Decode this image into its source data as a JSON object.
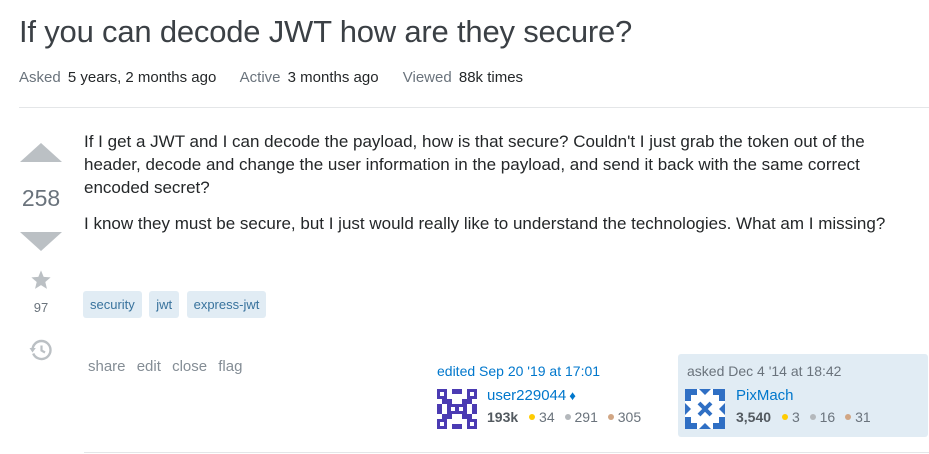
{
  "question": {
    "title": "If you can decode JWT how are they secure?",
    "meta": {
      "asked_label": "Asked",
      "asked_value": "5 years, 2 months ago",
      "active_label": "Active",
      "active_value": "3 months ago",
      "viewed_label": "Viewed",
      "viewed_value": "88k times"
    },
    "votes": {
      "score": "258",
      "favorites": "97"
    },
    "body": {
      "p1": "If I get a JWT and I can decode the payload, how is that secure? Couldn't I just grab the token out of the header, decode and change the user information in the payload, and send it back with the same correct encoded secret?",
      "p2": "I know they must be secure, but I just would really like to understand the technologies. What am I missing?"
    },
    "tags": [
      "security",
      "jwt",
      "express-jwt"
    ],
    "actions": [
      "share",
      "edit",
      "close",
      "flag"
    ],
    "editor": {
      "action": "edited Sep 20 '19 at 17:01",
      "name": "user229044",
      "moderator_glyph": "♦",
      "reputation": "193k",
      "gold": "34",
      "silver": "291",
      "bronze": "305"
    },
    "asker": {
      "action": "asked Dec 4 '14 at 18:42",
      "name": "PixMach",
      "reputation": "3,540",
      "gold": "3",
      "silver": "16",
      "bronze": "31"
    }
  },
  "icons": {
    "upvote": "arrow-up-icon",
    "downvote": "arrow-down-icon",
    "favorite": "star-icon",
    "history": "history-icon"
  },
  "colors": {
    "link": "#0077cc",
    "tag_bg": "#e1ecf4",
    "tag_text": "#39739d",
    "gold": "#ffcc01",
    "silver": "#b4b8bc",
    "bronze": "#d1a684",
    "muted": "#6a737c"
  }
}
